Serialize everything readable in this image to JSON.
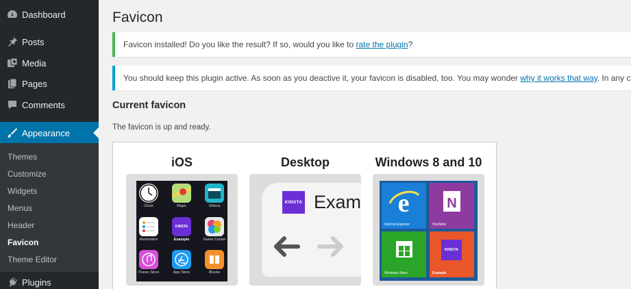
{
  "sidebar": {
    "menu": [
      {
        "label": "Dashboard",
        "icon": "dashboard-icon"
      },
      {
        "label": "Posts",
        "icon": "pin-icon"
      },
      {
        "label": "Media",
        "icon": "media-icon"
      },
      {
        "label": "Pages",
        "icon": "pages-icon"
      },
      {
        "label": "Comments",
        "icon": "comment-icon"
      },
      {
        "label": "Appearance",
        "icon": "paintbrush-icon"
      },
      {
        "label": "Plugins",
        "icon": "plug-icon"
      }
    ],
    "submenu": [
      "Themes",
      "Customize",
      "Widgets",
      "Menus",
      "Header",
      "Favicon",
      "Theme Editor"
    ],
    "active_submenu": "Favicon",
    "colors": {
      "bg": "#23282d",
      "active": "#0073aa",
      "submenu_bg": "#32373c"
    }
  },
  "page": {
    "title": "Favicon",
    "notice_success": {
      "text_before": "Favicon installed! Do you like the result? If so, would you like to ",
      "link": "rate the plugin",
      "text_after": "?"
    },
    "notice_info": {
      "text_before": "You should keep this plugin active. As soon as you deactive it, your favicon is disabled, too. You may wonder ",
      "link": "why it works that way",
      "text_after": ". In any case,"
    },
    "section_title": "Current favicon",
    "status_text": "The favicon is up and ready."
  },
  "preview": {
    "columns": [
      "iOS",
      "Desktop",
      "Windows 8 and 10"
    ],
    "ios_apps": [
      {
        "label": "Clock",
        "color": "#ffffff"
      },
      {
        "label": "Maps",
        "color": "#8bc34a"
      },
      {
        "label": "Videos",
        "color": "#22b5c9"
      },
      {
        "label": "Reminders",
        "color": "#ffffff"
      },
      {
        "label": "Example",
        "color": "#6b2fd6"
      },
      {
        "label": "Game Center",
        "color": "#e8e8e8"
      },
      {
        "label": "iTunes Store",
        "color": "#d84fd8"
      },
      {
        "label": "App Store",
        "color": "#1e9bf0"
      },
      {
        "label": "iBooks",
        "color": "#f5912b"
      }
    ],
    "desktop": {
      "favicon_text": "KINSTA",
      "tab_text": "Exam"
    },
    "windows_tiles": [
      {
        "label": "Internet Explorer",
        "color": "#1a7fd6"
      },
      {
        "label": "OneNote",
        "color": "#8e3b9f"
      },
      {
        "label": "Windows Store",
        "color": "#2aa52a"
      },
      {
        "label": "Example",
        "color": "#e8562a"
      }
    ],
    "kinsta_label": "KINSTA"
  }
}
